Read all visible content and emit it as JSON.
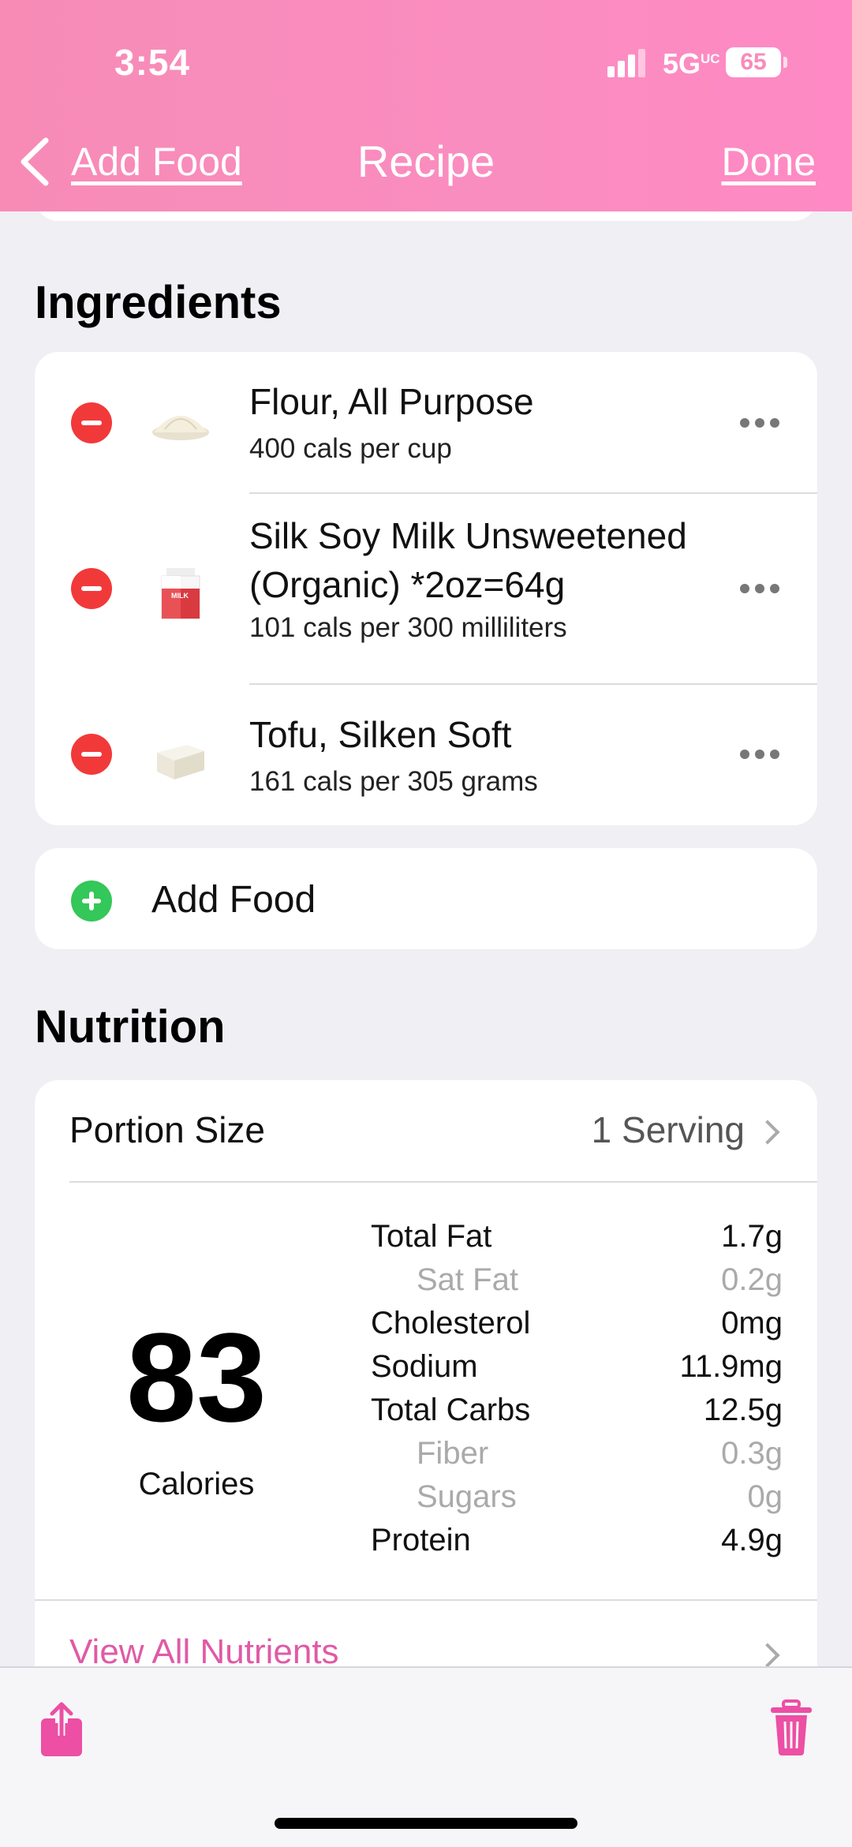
{
  "status_bar": {
    "time": "3:54",
    "network": "5G",
    "network_suffix": "UC",
    "battery": "65"
  },
  "nav": {
    "back_label": "Add Food",
    "title": "Recipe",
    "done_label": "Done"
  },
  "ingredients": {
    "section_title": "Ingredients",
    "items": [
      {
        "name": "Flour, All Purpose",
        "detail": "400 cals per cup",
        "icon": "flour-icon"
      },
      {
        "name_line1": "Silk Soy Milk Unsweetened",
        "name_line2": "(Organic) *2oz=64g",
        "detail": "101 cals per 300 milliliters",
        "icon": "milk-carton-icon"
      },
      {
        "name": "Tofu, Silken Soft",
        "detail": "161 cals per 305 grams",
        "icon": "tofu-icon"
      }
    ],
    "add_food_label": "Add Food"
  },
  "nutrition": {
    "section_title": "Nutrition",
    "portion_label": "Portion Size",
    "portion_value": "1 Serving",
    "calories_value": "83",
    "calories_label": "Calories",
    "rows": [
      {
        "label": "Total Fat",
        "value": "1.7g"
      },
      {
        "label": "Sat Fat",
        "value": "0.2g"
      },
      {
        "label": "Cholesterol",
        "value": "0mg"
      },
      {
        "label": "Sodium",
        "value": "11.9mg"
      },
      {
        "label": "Total Carbs",
        "value": "12.5g"
      },
      {
        "label": "Fiber",
        "value": "0.3g"
      },
      {
        "label": "Sugars",
        "value": "0g"
      },
      {
        "label": "Protein",
        "value": "4.9g"
      }
    ],
    "view_all_label": "View All Nutrients"
  },
  "toolbar": {
    "share_icon": "share-icon",
    "trash_icon": "trash-icon"
  },
  "colors": {
    "header_pink": "#fa8dc0",
    "accent_pink": "#e05aa6",
    "remove_red": "#f2393a",
    "add_green": "#34c759"
  }
}
